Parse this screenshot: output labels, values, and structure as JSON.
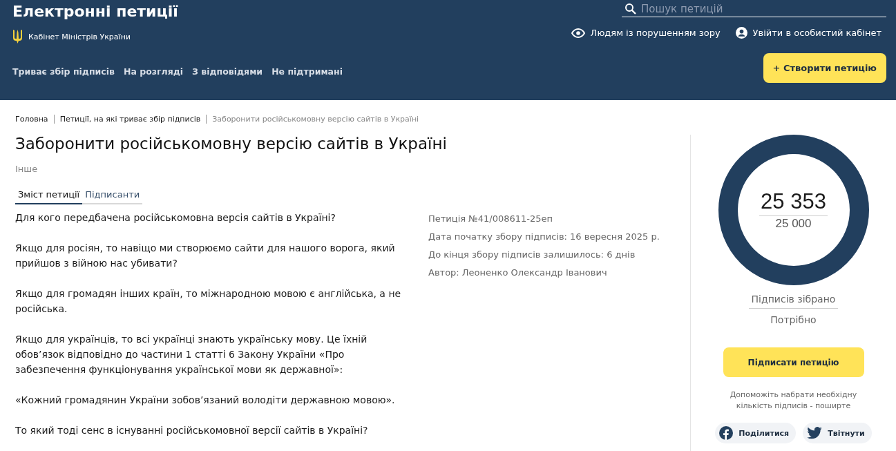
{
  "header": {
    "site_title": "Електронні петиції",
    "org": "Кабінет Міністрів України",
    "search": {
      "placeholder": "Пошук петицій"
    },
    "links": [
      {
        "kind": "eye",
        "label": "Людям із порушенням зору"
      },
      {
        "kind": "user",
        "label": "Увійти в особистий кабінет"
      }
    ],
    "nav": [
      {
        "label": "Триває збір підписів"
      },
      {
        "label": "На розгляді"
      },
      {
        "label": "З відповідями"
      },
      {
        "label": "Не підтримані"
      }
    ],
    "create_button": "+ Створити петицію"
  },
  "breadcrumbs": [
    {
      "label": "Головна",
      "current": false
    },
    {
      "label": "Петиції, на які триває збір підписів",
      "current": false
    },
    {
      "label": "Заборонити російськомовну версію сайтів в Україні",
      "current": true
    }
  ],
  "petition": {
    "title": "Заборонити російськомовну версію сайтів в Україні",
    "category": "Інше",
    "tabs": [
      {
        "label": "Зміст петиції",
        "selected": true
      },
      {
        "label": "Підписанти",
        "selected": false
      }
    ],
    "paragraphs": [
      "Для кого передбачена російськомовна версія сайтів в Україні?",
      "Якщо для росіян, то навіщо ми створюємо сайти для нашого ворога, який прийшов з війною нас убивати?",
      "Якщо для громадян інших країн, то міжнародною мовою є англійська, а не російська.",
      "Якщо для українців, то всі українці знають українську мову. Це їхній обов’язок відповідно до частини 1 статті 6 Закону України «Про забезпечення функціонування української мови як державної»:",
      "«Кожний громадянин України зобов’язаний володіти державною мовою».",
      "То який тоді сенс в існуванні російськомовної версії сайтів в Україні?"
    ],
    "meta": [
      "Петиція №41/008611-25еп",
      "Дата початку збору підписів: 16 вересня 2025 р.",
      "До кінця збору підписів залишилось: 6 днів",
      "Автор: Леоненко Олександр Іванович"
    ]
  },
  "sidebar": {
    "progress": {
      "level": 1,
      "count": "25 353",
      "goal": "25 000"
    },
    "collected_label": "Підписів зібрано",
    "needed_label": "Потрібно",
    "sign_button": "Підписати петицію",
    "share_hint": "Допоможіть набрати необхідну кількість підписів - поширте",
    "share_buttons": [
      {
        "kind": "facebook",
        "label": "Поділитися"
      },
      {
        "kind": "twitter",
        "label": "Твітнути"
      }
    ]
  }
}
